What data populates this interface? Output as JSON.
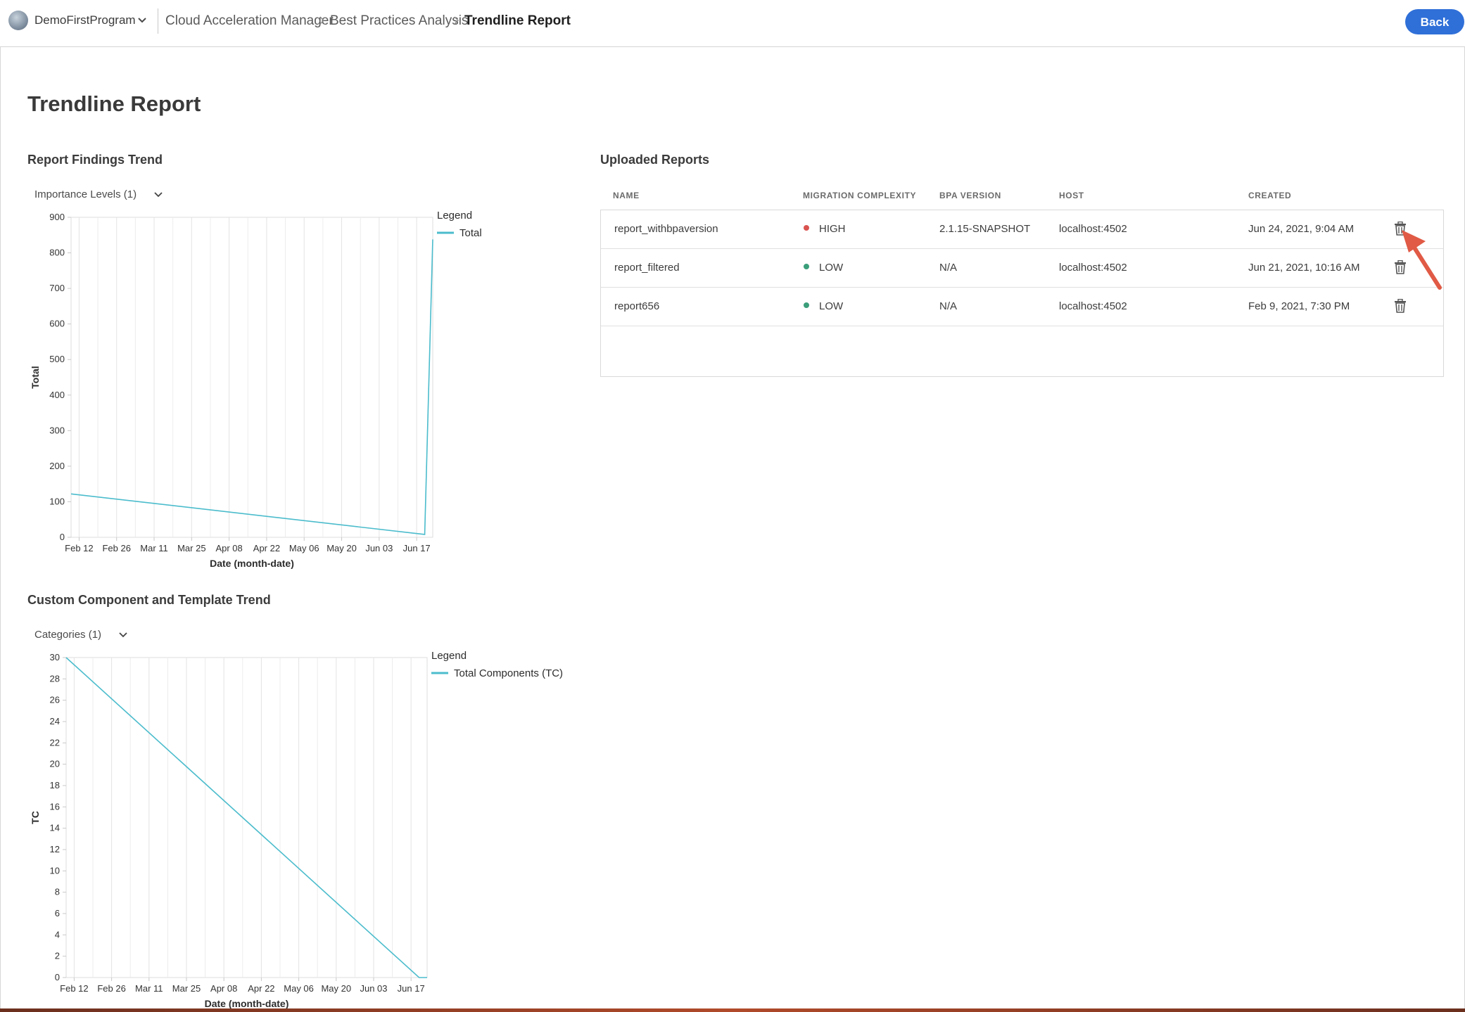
{
  "topbar": {
    "program_name": "DemoFirstProgram",
    "breadcrumb": [
      "Cloud Acceleration Manager",
      "Best Practices Analysis",
      "Trendline Report"
    ],
    "back_label": "Back"
  },
  "page": {
    "title": "Trendline Report"
  },
  "findings": {
    "title": "Report Findings Trend",
    "picker_label": "Importance Levels (1)"
  },
  "components": {
    "title": "Custom Component and Template Trend",
    "picker_label": "Categories (1)"
  },
  "reports": {
    "title": "Uploaded Reports",
    "columns": [
      "NAME",
      "MIGRATION COMPLEXITY",
      "BPA VERSION",
      "HOST",
      "CREATED"
    ],
    "rows": [
      {
        "name": "report_withbpaversion",
        "complexity": "HIGH",
        "complexity_color": "#d9534f",
        "bpa_version": "2.1.15-SNAPSHOT",
        "host": "localhost:4502",
        "created": "Jun 24, 2021, 9:04 AM"
      },
      {
        "name": "report_filtered",
        "complexity": "LOW",
        "complexity_color": "#3a9e7a",
        "bpa_version": "N/A",
        "host": "localhost:4502",
        "created": "Jun 21, 2021, 10:16 AM"
      },
      {
        "name": "report656",
        "complexity": "LOW",
        "complexity_color": "#3a9e7a",
        "bpa_version": "N/A",
        "host": "localhost:4502",
        "created": "Feb 9, 2021, 7:30 PM"
      }
    ]
  },
  "chart_data": [
    {
      "type": "line",
      "title": "",
      "xlabel": "Date (month-date)",
      "ylabel": "Total",
      "x": [
        "2021-02-09",
        "2021-06-21",
        "2021-06-24"
      ],
      "x_tick_labels": [
        "Feb 12",
        "Feb 26",
        "Mar 11",
        "Mar 25",
        "Apr 08",
        "Apr 22",
        "May 06",
        "May 20",
        "Jun 03",
        "Jun 17"
      ],
      "y_ticks": [
        0,
        100,
        200,
        300,
        400,
        500,
        600,
        700,
        800,
        900
      ],
      "ylim": [
        0,
        900
      ],
      "legend_title": "Legend",
      "legend_position": "top-right",
      "grid": true,
      "series": [
        {
          "name": "Total",
          "color": "#4bbccc",
          "values": [
            122,
            8,
            838
          ]
        }
      ]
    },
    {
      "type": "line",
      "title": "",
      "xlabel": "Date (month-date)",
      "ylabel": "TC",
      "x": [
        "2021-02-09",
        "2021-06-21",
        "2021-06-24"
      ],
      "x_tick_labels": [
        "Feb 12",
        "Feb 26",
        "Mar 11",
        "Mar 25",
        "Apr 08",
        "Apr 22",
        "May 06",
        "May 20",
        "Jun 03",
        "Jun 17"
      ],
      "y_ticks": [
        0,
        2,
        4,
        6,
        8,
        10,
        12,
        14,
        16,
        18,
        20,
        22,
        24,
        26,
        28,
        30
      ],
      "ylim": [
        0,
        30
      ],
      "legend_title": "Legend",
      "legend_position": "top-right",
      "grid": true,
      "series": [
        {
          "name": "Total Components (TC)",
          "color": "#4bbccc",
          "values": [
            30,
            0,
            0
          ]
        }
      ]
    }
  ]
}
